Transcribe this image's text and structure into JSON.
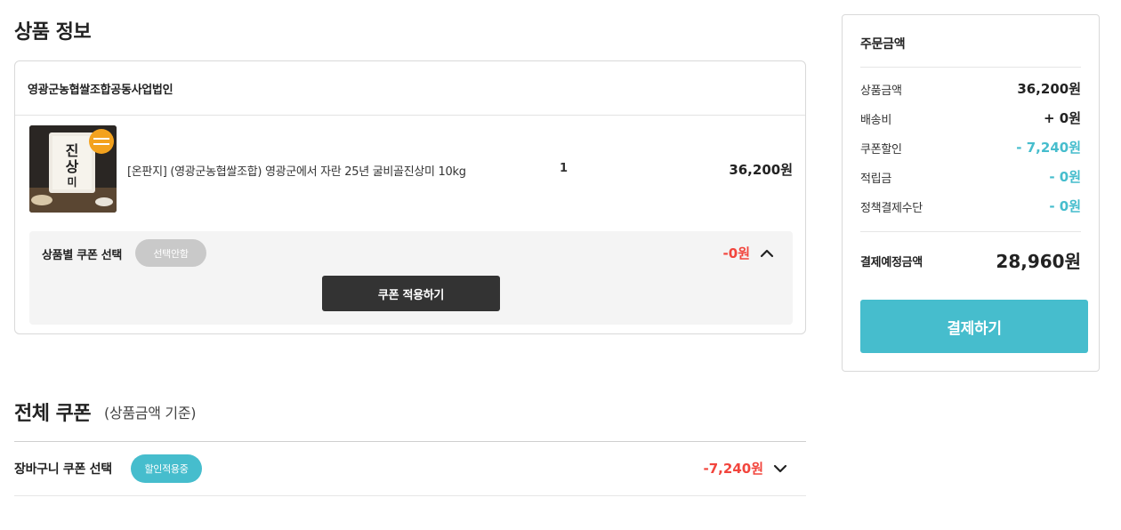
{
  "product_section": {
    "title": "상품 정보",
    "seller": "영광군농협쌀조합공동사업법인",
    "item": {
      "name": "[온판지] (영광군농협쌀조합) 영광군에서 자란 25년 굴비골진상미 10kg",
      "quantity": "1",
      "price": "36,200원",
      "image_icon": "rice-bag-product-image"
    },
    "coupon": {
      "label": "상품별 쿠폰 선택",
      "select_label": "선택안함",
      "amount": "-0원",
      "apply_label": "쿠폰 적용하기"
    }
  },
  "whole_coupon": {
    "title": "전체 쿠폰",
    "subtitle": "(상품금액 기준)",
    "cart_label": "장바구니 쿠폰 선택",
    "badge": "할인적용중",
    "amount": "-7,240원"
  },
  "summary": {
    "title": "주문금액",
    "rows": [
      {
        "label": "상품금액",
        "value": "36,200원"
      },
      {
        "label": "배송비",
        "value": "+ 0원"
      },
      {
        "label": "쿠폰할인",
        "value": "- 7,240원"
      },
      {
        "label": "적립금",
        "value": "- 0원"
      },
      {
        "label": "정책결제수단",
        "value": "- 0원"
      }
    ],
    "total_label": "결제예정금액",
    "total_value": "28,960원",
    "pay_label": "결제하기"
  },
  "colors": {
    "accent": "#46bdcd",
    "discount": "#f2453d",
    "dark_button": "#333333"
  }
}
